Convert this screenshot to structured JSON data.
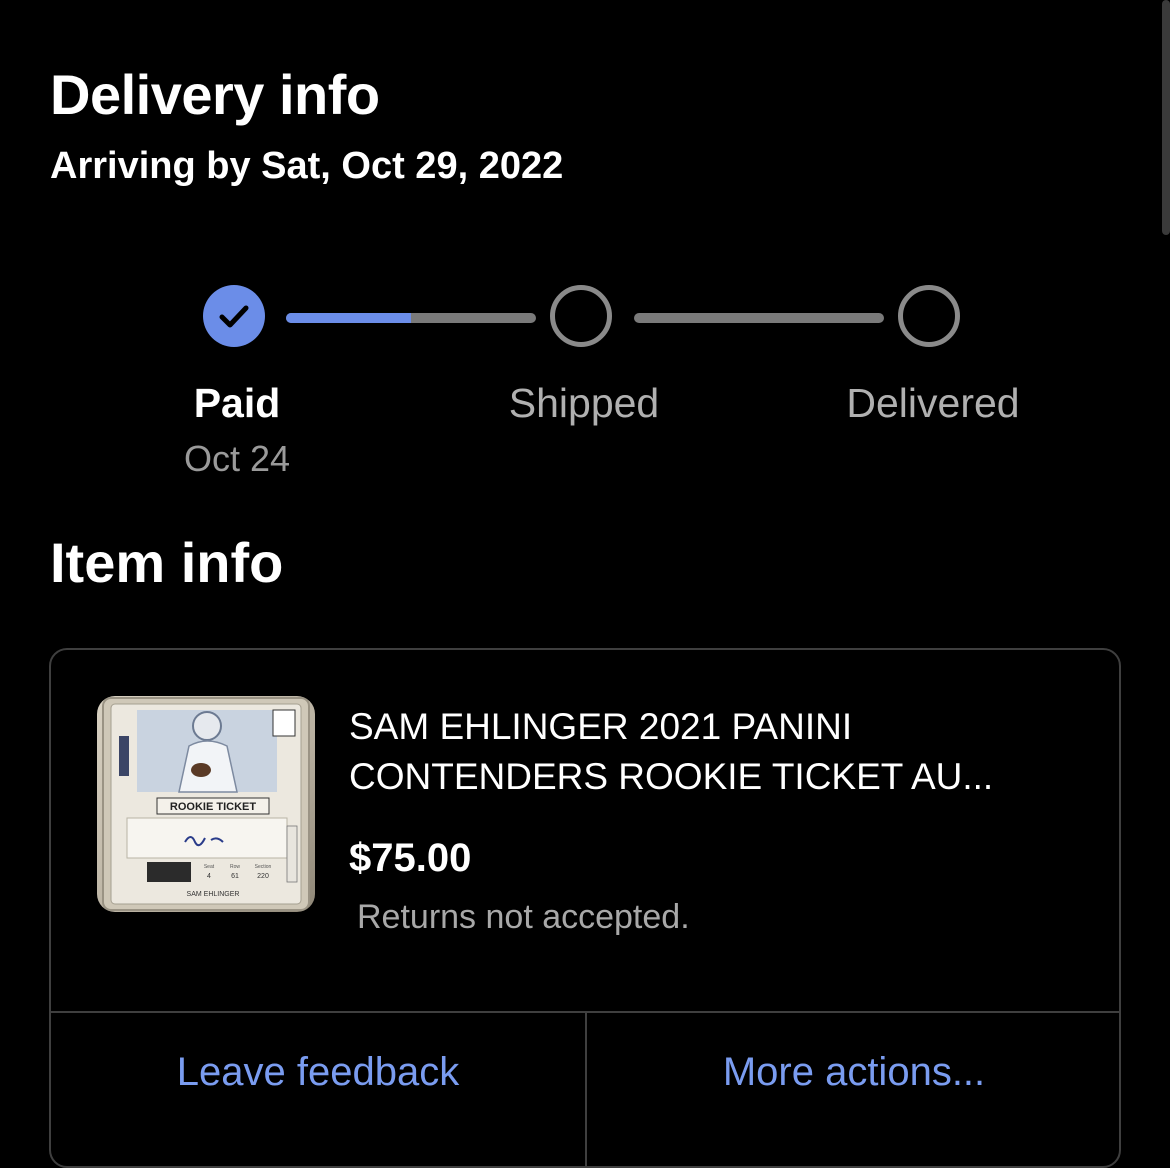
{
  "header": {
    "title": "Delivery info",
    "subtitle": "Arriving by Sat, Oct 29, 2022"
  },
  "tracker": {
    "progress_fraction": 0.5,
    "steps": [
      {
        "label": "Paid",
        "date": "Oct 24",
        "state": "done",
        "icon": "check-icon"
      },
      {
        "label": "Shipped",
        "state": "pending"
      },
      {
        "label": "Delivered",
        "state": "pending"
      }
    ]
  },
  "item_section": {
    "title": "Item info",
    "item": {
      "title": "SAM EHLINGER 2021 PANINI CONTENDERS ROOKIE TICKET AU...",
      "price": "$75.00",
      "returns": "Returns not accepted.",
      "thumbnail_text": {
        "banner": "ROOKIE TICKET",
        "seat_label": "Seat",
        "seat": "4",
        "row_label": "Row",
        "row": "61",
        "section_label": "Section",
        "section": "220",
        "name": "SAM EHLINGER"
      }
    },
    "actions": {
      "feedback_label": "Leave feedback",
      "more_label": "More actions..."
    }
  },
  "colors": {
    "background": "#000000",
    "accent": "#6b8de8",
    "link": "#7a9cf0",
    "track_inactive": "#7a7a7a"
  }
}
